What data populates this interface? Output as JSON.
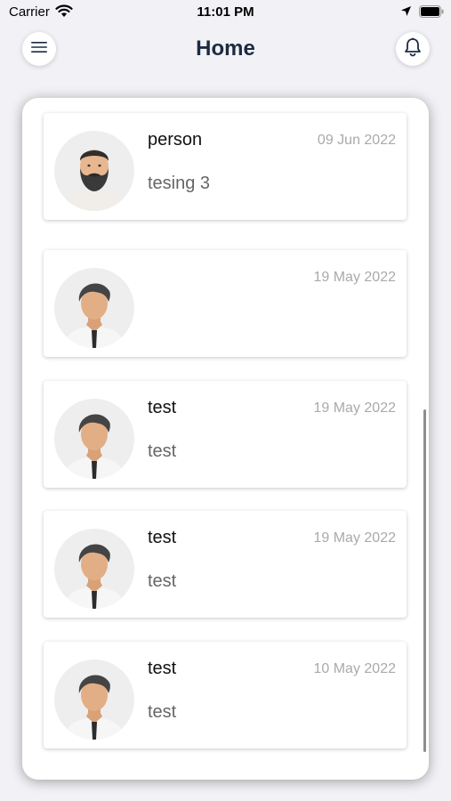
{
  "status_bar": {
    "carrier": "Carrier",
    "time": "11:01 PM",
    "wifi_icon": "wifi-icon",
    "location_icon": "location-arrow-icon",
    "battery_icon": "battery-full-icon"
  },
  "nav": {
    "title": "Home",
    "menu_icon": "hamburger-menu-icon",
    "bell_icon": "bell-icon"
  },
  "messages": [
    {
      "name": "person",
      "date": "09 Jun 2022",
      "message": "tesing 3",
      "avatar": "bearded-man-avatar"
    },
    {
      "name": "",
      "date": "19 May 2022",
      "message": "",
      "avatar": "man-tie-avatar"
    },
    {
      "name": "test",
      "date": "19 May 2022",
      "message": "test",
      "avatar": "man-tie-avatar"
    },
    {
      "name": "test",
      "date": "19 May 2022",
      "message": "test",
      "avatar": "man-tie-avatar"
    },
    {
      "name": "test",
      "date": "10 May 2022",
      "message": "test",
      "avatar": "man-tie-avatar"
    }
  ],
  "colors": {
    "background": "#f2f2f6",
    "title": "#1d2b41",
    "date": "#aaaaaa",
    "message": "#666666"
  }
}
